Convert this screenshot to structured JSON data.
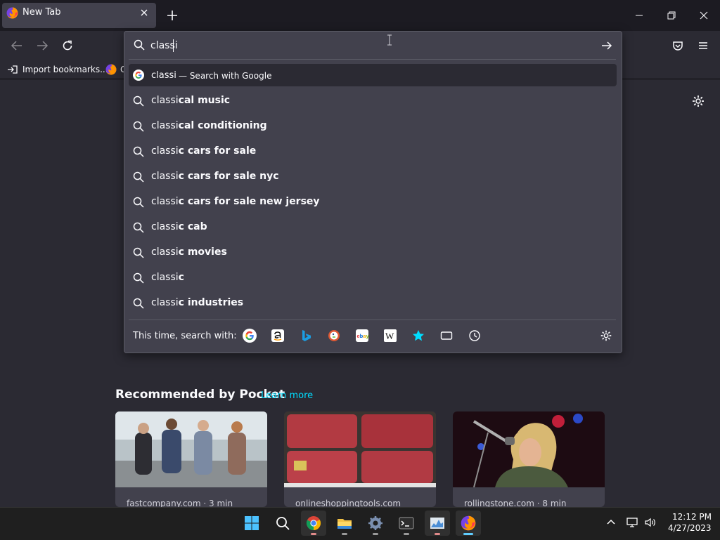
{
  "browser": {
    "tab": {
      "title": "New Tab",
      "favicon": "firefox-icon"
    },
    "bookmarks": {
      "import_label": "Import bookmarks...",
      "firefox_label": "G"
    }
  },
  "urlbar": {
    "value": "classi",
    "first_row": {
      "query": "classi",
      "action": "— Search with Google",
      "engine_icon": "google-icon"
    },
    "suggestions": [
      {
        "typed": "classi",
        "completion": "cal music"
      },
      {
        "typed": "classi",
        "completion": "cal conditioning"
      },
      {
        "typed": "classi",
        "completion": "c cars for sale"
      },
      {
        "typed": "classi",
        "completion": "c cars for sale nyc"
      },
      {
        "typed": "classi",
        "completion": "c cars for sale new jersey"
      },
      {
        "typed": "classi",
        "completion": "c cab"
      },
      {
        "typed": "classi",
        "completion": "c movies"
      },
      {
        "typed": "classi",
        "completion": "c"
      },
      {
        "typed": "classi",
        "completion": "c industries"
      }
    ],
    "one_off": {
      "label": "This time, search with:",
      "engines": [
        "google-icon",
        "amazon-icon",
        "bing-icon",
        "duckduckgo-icon",
        "ebay-icon",
        "wikipedia-icon",
        "bookmarks-star-icon",
        "tabs-icon",
        "history-icon"
      ]
    }
  },
  "newtab": {
    "pocket": {
      "heading": "Recommended by Pocket",
      "learn_more": "Learn more",
      "cards": [
        {
          "source": "fastcompany.com · 3 min"
        },
        {
          "source": "onlineshoppingtools.com"
        },
        {
          "source": "rollingstone.com · 8 min"
        }
      ]
    }
  },
  "taskbar": {
    "apps": [
      "windows-start-icon",
      "search-icon",
      "chrome-icon",
      "file-explorer-icon",
      "settings-icon",
      "terminal-icon",
      "system-monitor-icon",
      "firefox-icon"
    ],
    "clock": {
      "time": "12:12 PM",
      "date": "4/27/2023"
    }
  },
  "colors": {
    "accent": "#00ddff",
    "popup_bg": "#42414d",
    "page_bg": "#2b2a33",
    "titlebar_bg": "#1c1b22",
    "taskbar_active": "#60cdff"
  }
}
